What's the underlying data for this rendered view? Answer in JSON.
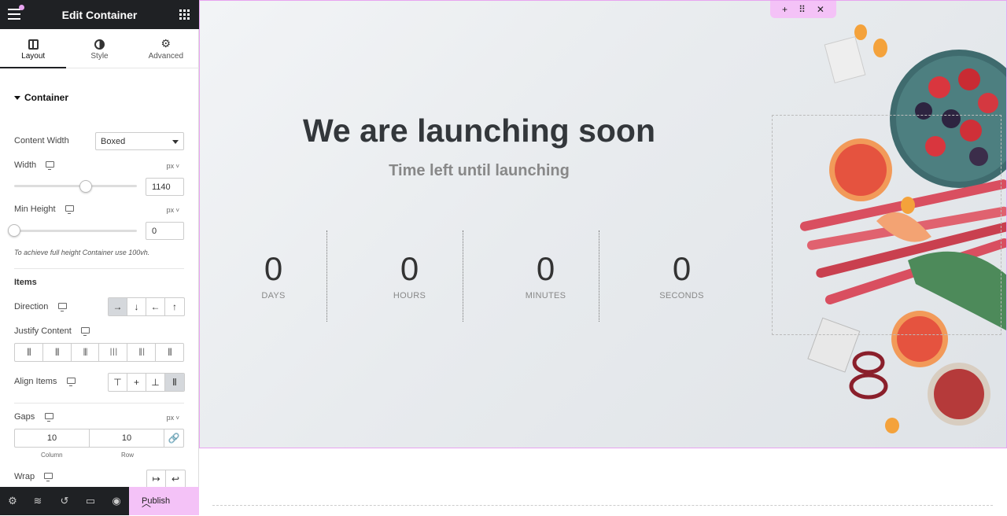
{
  "panel": {
    "title": "Edit Container",
    "tabs": [
      {
        "label": "Layout",
        "active": true
      },
      {
        "label": "Style",
        "active": false
      },
      {
        "label": "Advanced",
        "active": false
      }
    ],
    "section_title": "Container",
    "content_width": {
      "label": "Content Width",
      "value": "Boxed"
    },
    "width": {
      "label": "Width",
      "unit": "px",
      "value": "1140"
    },
    "min_height": {
      "label": "Min Height",
      "unit": "px",
      "value": "0"
    },
    "note": "To achieve full height Container use 100vh.",
    "items_title": "Items",
    "direction": {
      "label": "Direction"
    },
    "justify": {
      "label": "Justify Content"
    },
    "align": {
      "label": "Align Items"
    },
    "gaps": {
      "label": "Gaps",
      "unit": "px",
      "column": "10",
      "row": "10",
      "column_label": "Column",
      "row_label": "Row"
    },
    "wrap": {
      "label": "Wrap"
    },
    "publish_label": "Publish"
  },
  "hero": {
    "headline": "We are launching soon",
    "subline": "Time left until launching",
    "countdown": [
      {
        "value": "0",
        "label": "DAYS"
      },
      {
        "value": "0",
        "label": "HOURS"
      },
      {
        "value": "0",
        "label": "MINUTES"
      },
      {
        "value": "0",
        "label": "SECONDS"
      }
    ]
  },
  "colors": {
    "accent": "#f4c2f7",
    "dark": "#1f2124"
  }
}
